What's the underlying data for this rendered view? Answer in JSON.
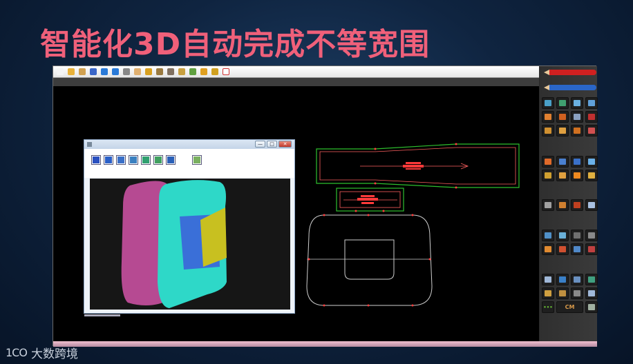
{
  "slide": {
    "title": "智能化3D自动完成不等宽围"
  },
  "toolbar": {
    "icons": [
      {
        "name": "new-file-icon",
        "color": "#f4f4f4"
      },
      {
        "name": "open-folder-icon",
        "color": "#e8b13a"
      },
      {
        "name": "recent-files-icon",
        "color": "#d0a050"
      },
      {
        "name": "save-icon",
        "color": "#3a66c8"
      },
      {
        "name": "undo-icon",
        "color": "#2a7ad8"
      },
      {
        "name": "redo-icon",
        "color": "#2a7ad8"
      },
      {
        "name": "delete-icon",
        "color": "#888888"
      },
      {
        "name": "hand-pan-icon",
        "color": "#e0b070"
      },
      {
        "name": "move-icon",
        "color": "#d8a020"
      },
      {
        "name": "grid-icon",
        "color": "#9a7a40"
      },
      {
        "name": "measure-icon",
        "color": "#807060"
      },
      {
        "name": "edit-line-icon",
        "color": "#c8a040"
      },
      {
        "name": "transform-icon",
        "color": "#60a040"
      },
      {
        "name": "pencil-draw-icon",
        "color": "#e0a020"
      },
      {
        "name": "knife-cut-icon",
        "color": "#d0a020"
      },
      {
        "name": "no-selection-icon",
        "color": "#d03030"
      }
    ]
  },
  "right_panel": {
    "pencils": [
      {
        "name": "red-pencil-icon",
        "color": "#d02020"
      },
      {
        "name": "blue-pencil-icon",
        "color": "#2a66c8"
      }
    ],
    "groups": [
      {
        "tools": [
          {
            "name": "pattern-tool-1-icon",
            "color": "#4aa0c8"
          },
          {
            "name": "pattern-tool-2-icon",
            "color": "#40a070"
          },
          {
            "name": "pattern-tool-3-icon",
            "color": "#6ab0e0"
          },
          {
            "name": "pattern-tool-4-icon",
            "color": "#60a0d8"
          },
          {
            "name": "pattern-tool-5-icon",
            "color": "#e08030"
          },
          {
            "name": "pattern-tool-6-icon",
            "color": "#d06020"
          },
          {
            "name": "pattern-tool-7-icon",
            "color": "#8aa0c0"
          },
          {
            "name": "pattern-tool-8-icon",
            "color": "#c03030"
          },
          {
            "name": "pattern-tool-9-icon",
            "color": "#d09030"
          },
          {
            "name": "pattern-tool-10-icon",
            "color": "#e0a040"
          },
          {
            "name": "pattern-tool-11-icon",
            "color": "#d07020"
          },
          {
            "name": "pattern-tool-12-icon",
            "color": "#d05050"
          }
        ]
      },
      {
        "tools": [
          {
            "name": "layout-tool-1-icon",
            "color": "#e06a2a"
          },
          {
            "name": "layout-tool-2-icon",
            "color": "#4a80d0"
          },
          {
            "name": "layout-tool-3-icon",
            "color": "#3a70c8"
          },
          {
            "name": "layout-tool-4-icon",
            "color": "#6ab0e8"
          },
          {
            "name": "layout-tool-5-icon",
            "color": "#d0a030"
          },
          {
            "name": "layout-tool-6-icon",
            "color": "#e0a040"
          },
          {
            "name": "layout-tool-7-icon",
            "color": "#f08a20"
          },
          {
            "name": "layout-tool-8-icon",
            "color": "#e0b040"
          }
        ]
      },
      {
        "tools": [
          {
            "name": "text-tool-1-icon",
            "color": "#a0a0a0"
          },
          {
            "name": "text-tool-2-icon",
            "color": "#d08030"
          },
          {
            "name": "text-tool-3-icon",
            "color": "#c04020"
          },
          {
            "name": "text-tool-4-icon",
            "color": "#a8c0e0"
          }
        ]
      },
      {
        "tools": [
          {
            "name": "edit-tool-1-icon",
            "color": "#5090c8"
          },
          {
            "name": "edit-tool-2-icon",
            "color": "#6ab0d8"
          },
          {
            "name": "edit-tool-3-icon",
            "color": "#707070"
          },
          {
            "name": "edit-tool-4-icon",
            "color": "#8a8a8a"
          },
          {
            "name": "edit-tool-5-icon",
            "color": "#e08a30"
          },
          {
            "name": "edit-tool-6-icon",
            "color": "#d05030"
          },
          {
            "name": "edit-tool-7-icon",
            "color": "#5088c8"
          },
          {
            "name": "edit-tool-8-icon",
            "color": "#c04040"
          }
        ]
      },
      {
        "tools": [
          {
            "name": "output-tool-1-icon",
            "color": "#a0b8d8"
          },
          {
            "name": "output-tool-2-icon",
            "color": "#3a80c8"
          },
          {
            "name": "output-tool-3-icon",
            "color": "#6a90c0"
          },
          {
            "name": "output-tool-4-icon",
            "color": "#40a080"
          },
          {
            "name": "output-tool-5-icon",
            "color": "#d0a040"
          },
          {
            "name": "output-tool-6-icon",
            "color": "#c09040"
          },
          {
            "name": "output-tool-7-icon",
            "color": "#8a8a8a"
          },
          {
            "name": "output-tool-8-icon",
            "color": "#a0b8d8"
          }
        ]
      }
    ],
    "unit_label": "CM"
  },
  "viewer": {
    "toolbar_icons": [
      {
        "name": "view-front-icon",
        "color": "#2a50c0"
      },
      {
        "name": "view-back-icon",
        "color": "#2a60c8"
      },
      {
        "name": "view-top-icon",
        "color": "#3a70c8"
      },
      {
        "name": "view-side-icon",
        "color": "#3a80c0"
      },
      {
        "name": "rotate-left-icon",
        "color": "#30a070"
      },
      {
        "name": "rotate-right-icon",
        "color": "#40a060"
      },
      {
        "name": "reset-view-icon",
        "color": "#2a60b8"
      },
      {
        "name": "export-icon",
        "color": "#7ab060"
      }
    ],
    "min_label": "—",
    "max_label": "□",
    "close_label": "✕"
  },
  "colors": {
    "pattern_outer": "#2ec02e",
    "pattern_inner": "#ff6060",
    "cad_lines": "#cfcfcf",
    "model_magenta": "#b64a92",
    "model_cyan": "#2ed8c8",
    "model_blue": "#3a6fd8",
    "model_olive": "#c8c020"
  },
  "watermark": {
    "logo": "1CO",
    "text": "大数跨境"
  }
}
